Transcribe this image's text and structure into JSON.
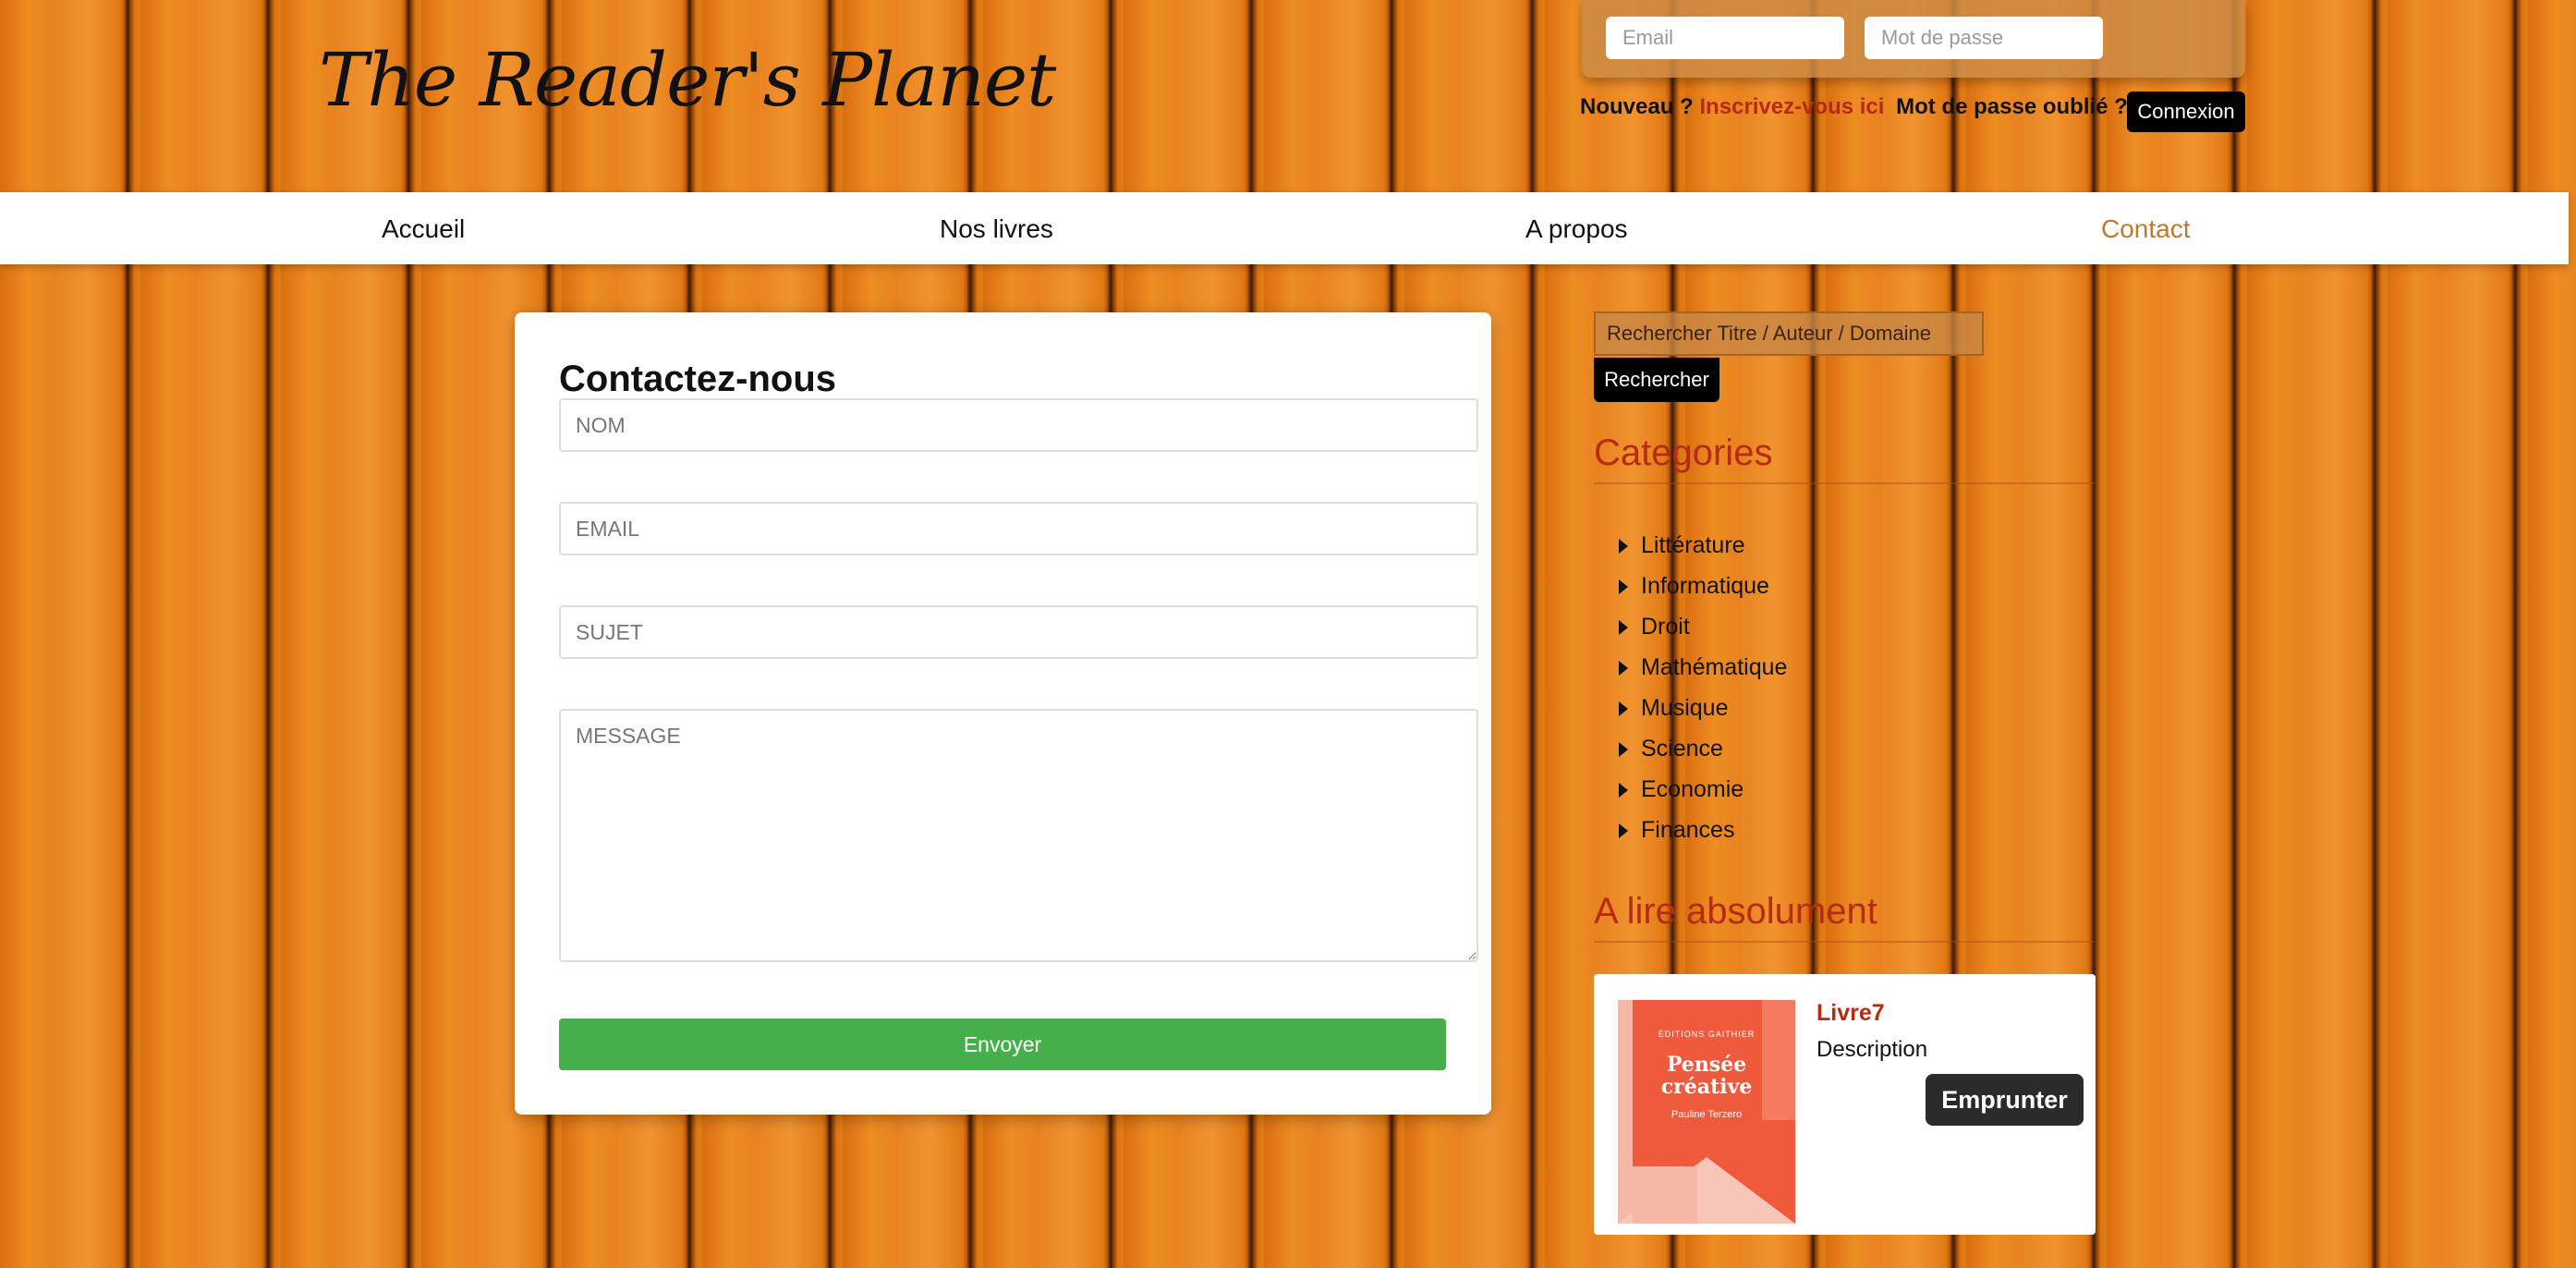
{
  "header": {
    "logo": "The Reader's Planet",
    "login": {
      "email_placeholder": "Email",
      "password_placeholder": "Mot de passe",
      "new_label": "Nouveau ?",
      "signup_link": "Inscrivez-vous ici",
      "forgot_link": "Mot de passe oublié ?",
      "login_button": "Connexion"
    }
  },
  "nav": {
    "items": [
      "Accueil",
      "Nos livres",
      "A propos",
      "Contact"
    ],
    "active": "Contact"
  },
  "contact": {
    "title": "Contactez-nous",
    "name_placeholder": "NOM",
    "email_placeholder": "EMAIL",
    "subject_placeholder": "SUJET",
    "message_placeholder": "MESSAGE",
    "send_button": "Envoyer"
  },
  "sidebar": {
    "search_placeholder": "Rechercher Titre / Auteur / Domaine",
    "search_button": "Rechercher",
    "categories_title": "Categories",
    "categories": [
      "Littérature",
      "Informatique",
      "Droit",
      "Mathématique",
      "Musique",
      "Science",
      "Economie",
      "Finances"
    ],
    "featured_title": "A lire absolument",
    "featured_book": {
      "title": "Livre7",
      "description": "Description",
      "borrow_button": "Emprunter",
      "cover": {
        "publisher": "ÉDITIONS GAITHIER",
        "title": "Pensée créative",
        "author": "Pauline Terzero"
      }
    }
  },
  "colors": {
    "accent_red": "#b62b12",
    "nav_active": "#c0782e",
    "send_green": "#46af4b"
  }
}
